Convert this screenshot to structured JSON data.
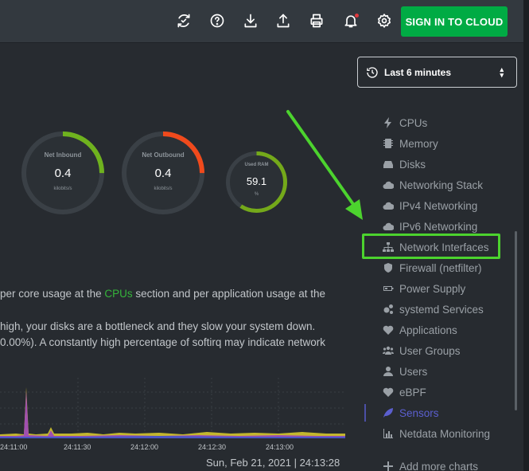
{
  "toolbar": {
    "icons": [
      "sync-icon",
      "help-icon",
      "download-icon",
      "upload-icon",
      "print-icon",
      "notification-icon",
      "settings-icon"
    ],
    "signin_label": "SIGN IN TO CLOUD",
    "accent": "#00ab44"
  },
  "timepicker": {
    "label": "Last 6 minutes"
  },
  "gauges": [
    {
      "title": "Net Inbound",
      "value": "0.4",
      "unit": "kilobits/s",
      "color": "#6fb21e",
      "fraction": 0.25
    },
    {
      "title": "Net Outbound",
      "value": "0.4",
      "unit": "kilobits/s",
      "color": "#f04a1c",
      "fraction": 0.25
    },
    {
      "title": "Used RAM",
      "value": "59.1",
      "unit": "%",
      "color": "#74a91a",
      "fraction": 0.591
    }
  ],
  "text": {
    "line1_before": "per core usage at the ",
    "line1_link": "CPUs",
    "line1_after": " section and per application usage at the",
    "line2": "high, your disks are a bottleneck and they slow your system down.",
    "line3": "0.00%). A constantly high percentage of softirq may indicate network"
  },
  "chart": {
    "x_ticks": [
      "24:11:00",
      "24:11:30",
      "24:12:00",
      "24:12:30",
      "24:13:00"
    ],
    "date": "Sun, Feb 21, 2021 | 24:13:28"
  },
  "menu": [
    {
      "label": "CPUs",
      "icon": "bolt-icon"
    },
    {
      "label": "Memory",
      "icon": "memory-icon"
    },
    {
      "label": "Disks",
      "icon": "hdd-icon"
    },
    {
      "label": "Networking Stack",
      "icon": "cloud-icon"
    },
    {
      "label": "IPv4 Networking",
      "icon": "cloud-icon"
    },
    {
      "label": "IPv6 Networking",
      "icon": "cloud-icon"
    },
    {
      "label": "Network Interfaces",
      "icon": "sitemap-icon"
    },
    {
      "label": "Firewall (netfilter)",
      "icon": "shield-icon"
    },
    {
      "label": "Power Supply",
      "icon": "battery-icon"
    },
    {
      "label": "systemd Services",
      "icon": "cogs-icon"
    },
    {
      "label": "Applications",
      "icon": "heartbeat-icon"
    },
    {
      "label": "User Groups",
      "icon": "users-icon"
    },
    {
      "label": "Users",
      "icon": "user-icon"
    },
    {
      "label": "eBPF",
      "icon": "heartbeat-icon"
    },
    {
      "label": "Sensors",
      "icon": "leaf-icon"
    },
    {
      "label": "Netdata Monitoring",
      "icon": "bar-chart-icon"
    },
    {
      "label": "Add more charts",
      "icon": "plus-icon"
    }
  ]
}
